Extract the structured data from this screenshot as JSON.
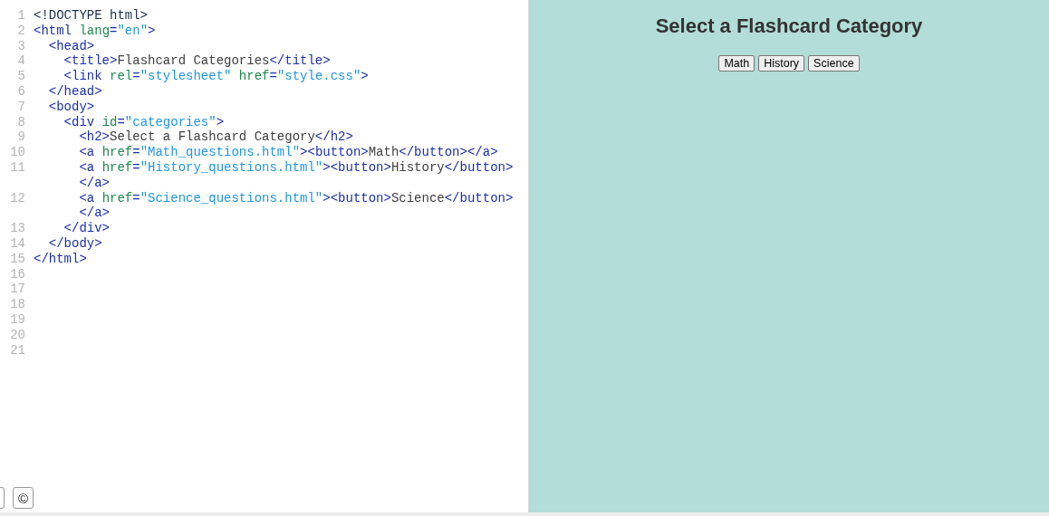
{
  "editor": {
    "lines": [
      {
        "number": "1",
        "rows": [
          [
            {
              "kind": "doctype",
              "text": "<!DOCTYPE html>"
            }
          ]
        ]
      },
      {
        "number": "2",
        "rows": [
          [
            {
              "kind": "tag",
              "text": "<html "
            },
            {
              "kind": "attr",
              "text": "lang"
            },
            {
              "kind": "tag",
              "text": "="
            },
            {
              "kind": "string",
              "text": "\"en\""
            },
            {
              "kind": "tag",
              "text": ">"
            }
          ]
        ]
      },
      {
        "number": "3",
        "rows": [
          [
            {
              "kind": "tag",
              "text": "  <head>"
            }
          ]
        ]
      },
      {
        "number": "4",
        "rows": [
          [
            {
              "kind": "tag",
              "text": "    <title>"
            },
            {
              "kind": "text",
              "text": "Flashcard Categories"
            },
            {
              "kind": "tag",
              "text": "</title>"
            }
          ]
        ]
      },
      {
        "number": "5",
        "rows": [
          [
            {
              "kind": "tag",
              "text": "    <link "
            },
            {
              "kind": "attr",
              "text": "rel"
            },
            {
              "kind": "tag",
              "text": "="
            },
            {
              "kind": "string",
              "text": "\"stylesheet\""
            },
            {
              "kind": "attr",
              "text": " href"
            },
            {
              "kind": "tag",
              "text": "="
            },
            {
              "kind": "string",
              "text": "\"style.css\""
            },
            {
              "kind": "tag",
              "text": ">"
            }
          ]
        ]
      },
      {
        "number": "6",
        "rows": [
          [
            {
              "kind": "tag",
              "text": "  </head>"
            }
          ]
        ]
      },
      {
        "number": "7",
        "rows": [
          [
            {
              "kind": "tag",
              "text": "  <body>"
            }
          ]
        ]
      },
      {
        "number": "8",
        "rows": [
          [
            {
              "kind": "tag",
              "text": "    <div "
            },
            {
              "kind": "attr",
              "text": "id"
            },
            {
              "kind": "tag",
              "text": "="
            },
            {
              "kind": "string",
              "text": "\"categories\""
            },
            {
              "kind": "tag",
              "text": ">"
            }
          ]
        ]
      },
      {
        "number": "9",
        "rows": [
          [
            {
              "kind": "tag",
              "text": "      <h2>"
            },
            {
              "kind": "text",
              "text": "Select a Flashcard Category"
            },
            {
              "kind": "tag",
              "text": "</h2>"
            }
          ]
        ]
      },
      {
        "number": "10",
        "rows": [
          [
            {
              "kind": "tag",
              "text": "      <a "
            },
            {
              "kind": "attr",
              "text": "href"
            },
            {
              "kind": "tag",
              "text": "="
            },
            {
              "kind": "string",
              "text": "\"Math_questions.html\""
            },
            {
              "kind": "tag",
              "text": "><button>"
            },
            {
              "kind": "text",
              "text": "Math"
            },
            {
              "kind": "tag",
              "text": "</button></a>"
            }
          ]
        ]
      },
      {
        "number": "11",
        "rows": [
          [
            {
              "kind": "tag",
              "text": "      <a "
            },
            {
              "kind": "attr",
              "text": "href"
            },
            {
              "kind": "tag",
              "text": "="
            },
            {
              "kind": "string",
              "text": "\"History_questions.html\""
            },
            {
              "kind": "tag",
              "text": "><button>"
            },
            {
              "kind": "text",
              "text": "History"
            },
            {
              "kind": "tag",
              "text": "</button>"
            }
          ],
          [
            {
              "kind": "tag",
              "text": "      </a>"
            }
          ]
        ]
      },
      {
        "number": "12",
        "rows": [
          [
            {
              "kind": "tag",
              "text": "      <a "
            },
            {
              "kind": "attr",
              "text": "href"
            },
            {
              "kind": "tag",
              "text": "="
            },
            {
              "kind": "string",
              "text": "\"Science_questions.html\""
            },
            {
              "kind": "tag",
              "text": "><button>"
            },
            {
              "kind": "text",
              "text": "Science"
            },
            {
              "kind": "tag",
              "text": "</button>"
            }
          ],
          [
            {
              "kind": "tag",
              "text": "      </a>"
            }
          ]
        ]
      },
      {
        "number": "13",
        "rows": [
          [
            {
              "kind": "tag",
              "text": "    </div>"
            }
          ]
        ]
      },
      {
        "number": "14",
        "rows": [
          [
            {
              "kind": "tag",
              "text": "  </body>"
            }
          ]
        ]
      },
      {
        "number": "15",
        "rows": [
          [
            {
              "kind": "tag",
              "text": "</html>"
            }
          ]
        ]
      },
      {
        "number": "16"
      },
      {
        "number": "17"
      },
      {
        "number": "18"
      },
      {
        "number": "19"
      },
      {
        "number": "20"
      },
      {
        "number": "21"
      }
    ],
    "footer_button": "©"
  },
  "preview": {
    "heading": "Select a Flashcard Category",
    "buttons": [
      "Math",
      "History",
      "Science"
    ]
  }
}
